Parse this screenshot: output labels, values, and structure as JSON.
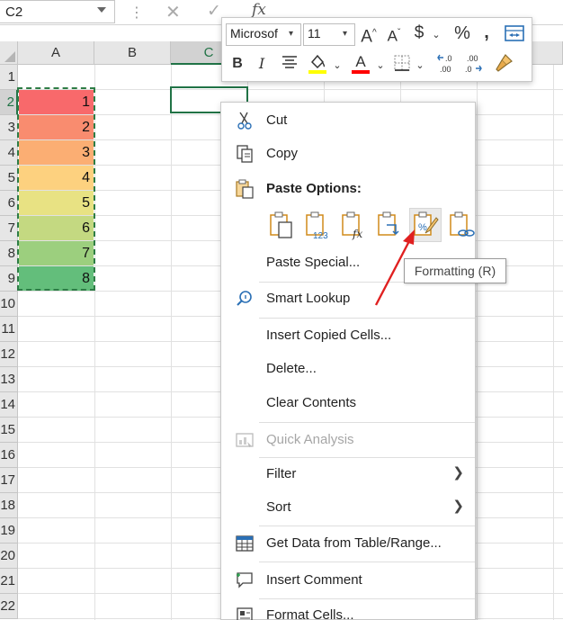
{
  "formula_bar": {
    "name_box": "C2",
    "fx_label": "fx"
  },
  "grid": {
    "columns": [
      "A",
      "B",
      "C"
    ],
    "rows": [
      "1",
      "2",
      "3",
      "4",
      "5",
      "6",
      "7",
      "8",
      "9",
      "10",
      "11",
      "12",
      "13",
      "14",
      "15",
      "16",
      "17",
      "18",
      "19",
      "20",
      "21",
      "22"
    ],
    "column_a_values": [
      "1",
      "2",
      "3",
      "4",
      "5",
      "6",
      "7",
      "8"
    ],
    "column_a_fill_colors": [
      "#f8696b",
      "#f98c6f",
      "#fbae73",
      "#fdd17f",
      "#e8e283",
      "#c4d981",
      "#9ccf7e",
      "#63be7b"
    ],
    "accent_color": "#217346"
  },
  "mini_toolbar": {
    "font_name": "Microsof",
    "font_size": "11",
    "highlight_color": "#ffff00",
    "font_color": "#ff0000"
  },
  "context_menu": {
    "cut": "Cut",
    "copy": "Copy",
    "paste_options": "Paste Options:",
    "paste_special": "Paste Special...",
    "smart_lookup": "Smart Lookup",
    "insert_copied_cells": "Insert Copied Cells...",
    "delete": "Delete...",
    "clear_contents": "Clear Contents",
    "quick_analysis": "Quick Analysis",
    "filter": "Filter",
    "sort": "Sort",
    "get_data": "Get Data from Table/Range...",
    "insert_comment": "Insert Comment",
    "format_cells": "Format Cells..."
  },
  "tooltip": "Formatting (R)",
  "annotation_color": "#e02020"
}
